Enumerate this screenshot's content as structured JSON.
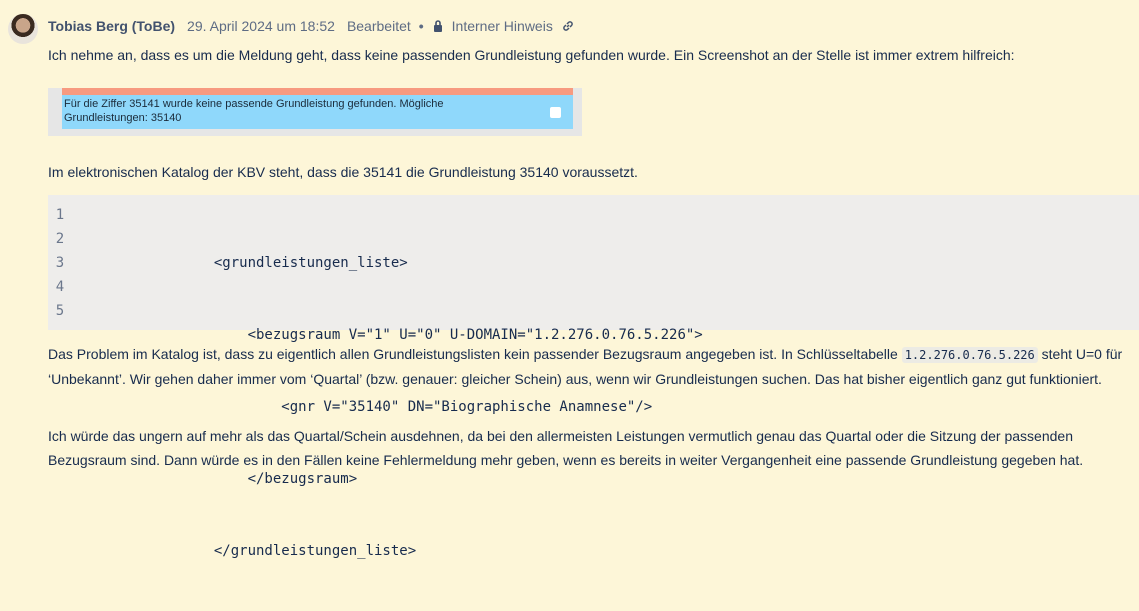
{
  "comment": {
    "author": "Tobias Berg (ToBe)",
    "date": "29. April 2024 um 18:52",
    "edited": "Bearbeitet",
    "separator": "•",
    "restriction": "Interner Hinweis",
    "icons": {
      "lock": "lock-icon",
      "link": "link-icon"
    }
  },
  "paragraph1": "Ich nehme an, dass es um die Meldung geht, dass keine passenden Grundleistung gefunden wurde. Ein Screenshot an der Stelle ist immer extrem hilfreich:",
  "screenshot": {
    "message_line1": "Für die Ziffer 35141 wurde keine passende Grundleistung gefunden. Mögliche",
    "message_line2": "Grundleistungen: 35140"
  },
  "paragraph2": "Im elektronischen Katalog der KBV steht, dass die 35141 die Grundleistung 35140 voraussetzt.",
  "code_block": {
    "line_numbers": [
      "1",
      "2",
      "3",
      "4",
      "5"
    ],
    "lines": [
      "                <grundleistungen_liste>",
      "                    <bezugsraum V=\"1\" U=\"0\" U-DOMAIN=\"1.2.276.0.76.5.226\">",
      "                        <gnr V=\"35140\" DN=\"Biographische Anamnese\"/>",
      "                    </bezugsraum>",
      "                </grundleistungen_liste>"
    ]
  },
  "paragraph3": {
    "before_code": "Das Problem im Katalog ist, dass zu eigentlich allen Grundleistungslisten kein passender Bezugsraum angegeben ist. In Schlüsseltabelle ",
    "inline_code": "1.2.276.0.76.5.226",
    "after_code": " steht U=0 für ‘Unbekannt’. Wir gehen daher immer vom ‘Quartal’ (bzw. genauer: gleicher Schein) aus, wenn wir Grundleistungen suchen. Das hat bisher eigentlich ganz gut funktioniert."
  },
  "paragraph4": "Ich würde das ungern auf mehr als das Quartal/Schein ausdehnen, da bei den allermeisten Leistungen vermutlich genau das Quartal oder die Sitzung der passenden Bezugsraum sind. Dann würde es in den Fällen keine Fehlermeldung mehr geben, wenn es bereits in weiter Vergangenheit eine passende Grundleistung gegeben hat."
}
